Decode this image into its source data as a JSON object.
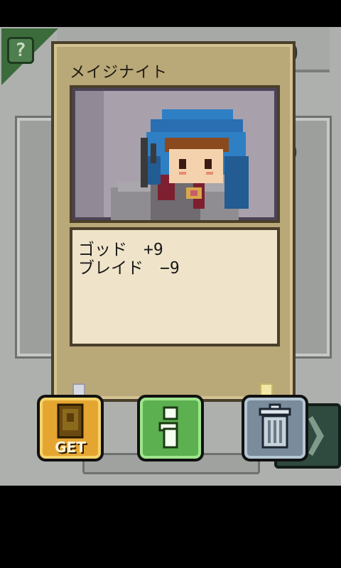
{
  "card": {
    "name": "メイジナイト",
    "stats": [
      "ゴッド　+9",
      "ブレイド　−9"
    ]
  },
  "background": {
    "coin_value": "0",
    "coin_value_2": "0"
  },
  "buttons": {
    "get_label": "GET"
  },
  "icons": {
    "help": "question-icon",
    "get": "card-get-icon",
    "info": "info-icon",
    "trash": "trash-can-icon"
  },
  "colors": {
    "card_gold": "#b9a878",
    "get_orange": "#e5a631",
    "info_green": "#5cb04f",
    "trash_blue": "#7a8c9c",
    "hair_blue": "#2f7fc4"
  }
}
